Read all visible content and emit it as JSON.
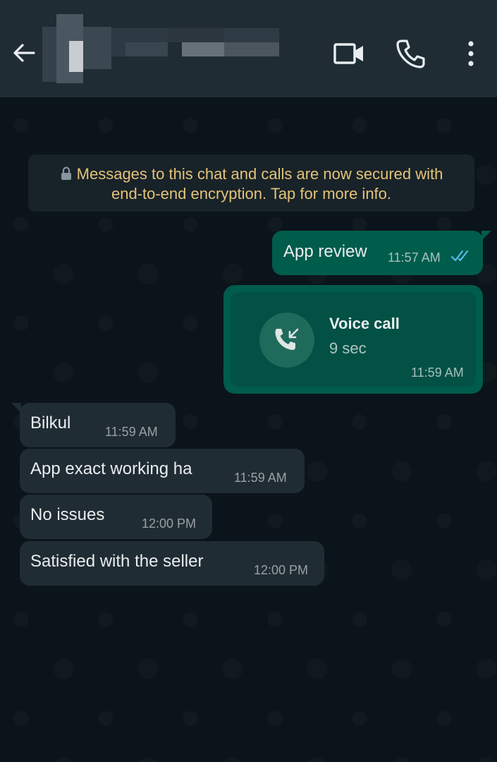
{
  "header": {
    "back_icon": "arrow-left-icon",
    "contact_name": "",
    "video_icon": "video-camera-icon",
    "call_icon": "phone-icon",
    "menu_icon": "more-vertical-icon"
  },
  "encryption_notice": {
    "icon": "lock-icon",
    "text_line1": "Messages to this chat and calls are now secured with",
    "text_line2": "end-to-end encryption. Tap for more info."
  },
  "messages": [
    {
      "direction": "outgoing",
      "text": "App review",
      "time": "11:57 AM",
      "status": "read",
      "status_icon": "double-check-icon"
    },
    {
      "direction": "outgoing",
      "type": "voice_call",
      "title": "Voice call",
      "duration": "9 sec",
      "time": "11:59 AM",
      "icon": "incoming-call-icon"
    },
    {
      "direction": "incoming",
      "text": "Bilkul",
      "time": "11:59 AM"
    },
    {
      "direction": "incoming",
      "text": "App exact working ha",
      "time": "11:59 AM"
    },
    {
      "direction": "incoming",
      "text": "No issues",
      "time": "12:00 PM"
    },
    {
      "direction": "incoming",
      "text": "Satisfied with the seller",
      "time": "12:00 PM"
    }
  ],
  "colors": {
    "header_bg": "#1f2c34",
    "chat_bg": "#0b141a",
    "outgoing_bubble": "#005c4b",
    "incoming_bubble": "#202c33",
    "notice_text": "#e3c377",
    "read_tick": "#53bdeb"
  }
}
